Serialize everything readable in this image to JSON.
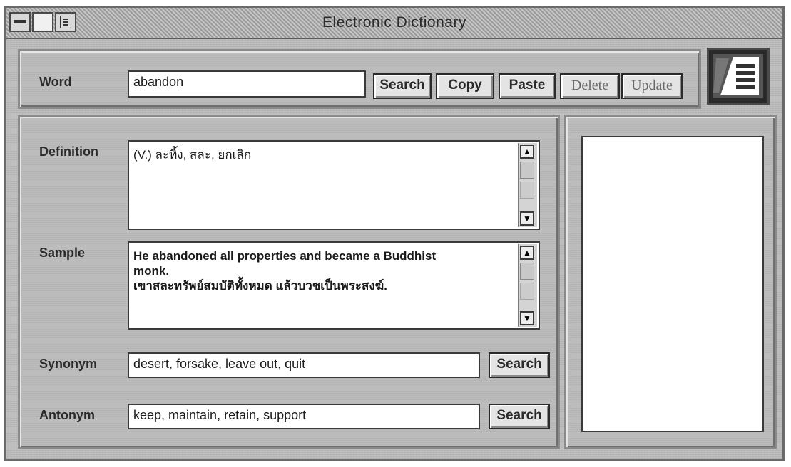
{
  "window": {
    "title": "Electronic Dictionary"
  },
  "word": {
    "label": "Word",
    "value": "abandon",
    "buttons": {
      "search": "Search",
      "copy": "Copy",
      "paste": "Paste",
      "delete": "Delete",
      "update": "Update"
    }
  },
  "definition": {
    "label": "Definition",
    "text": "(V.) ละทิ้ง, สละ, ยกเลิก"
  },
  "sample": {
    "label": "Sample",
    "line1": "He abandoned all properties and became a Buddhist",
    "line2": "monk.",
    "line3": "เขาสละทรัพย์สมบัติทั้งหมด แล้วบวชเป็นพระสงฆ์."
  },
  "synonym": {
    "label": "Synonym",
    "value": "desert, forsake, leave out, quit",
    "search": "Search"
  },
  "antonym": {
    "label": "Antonym",
    "value": "keep, maintain, retain, support",
    "search": "Search"
  }
}
